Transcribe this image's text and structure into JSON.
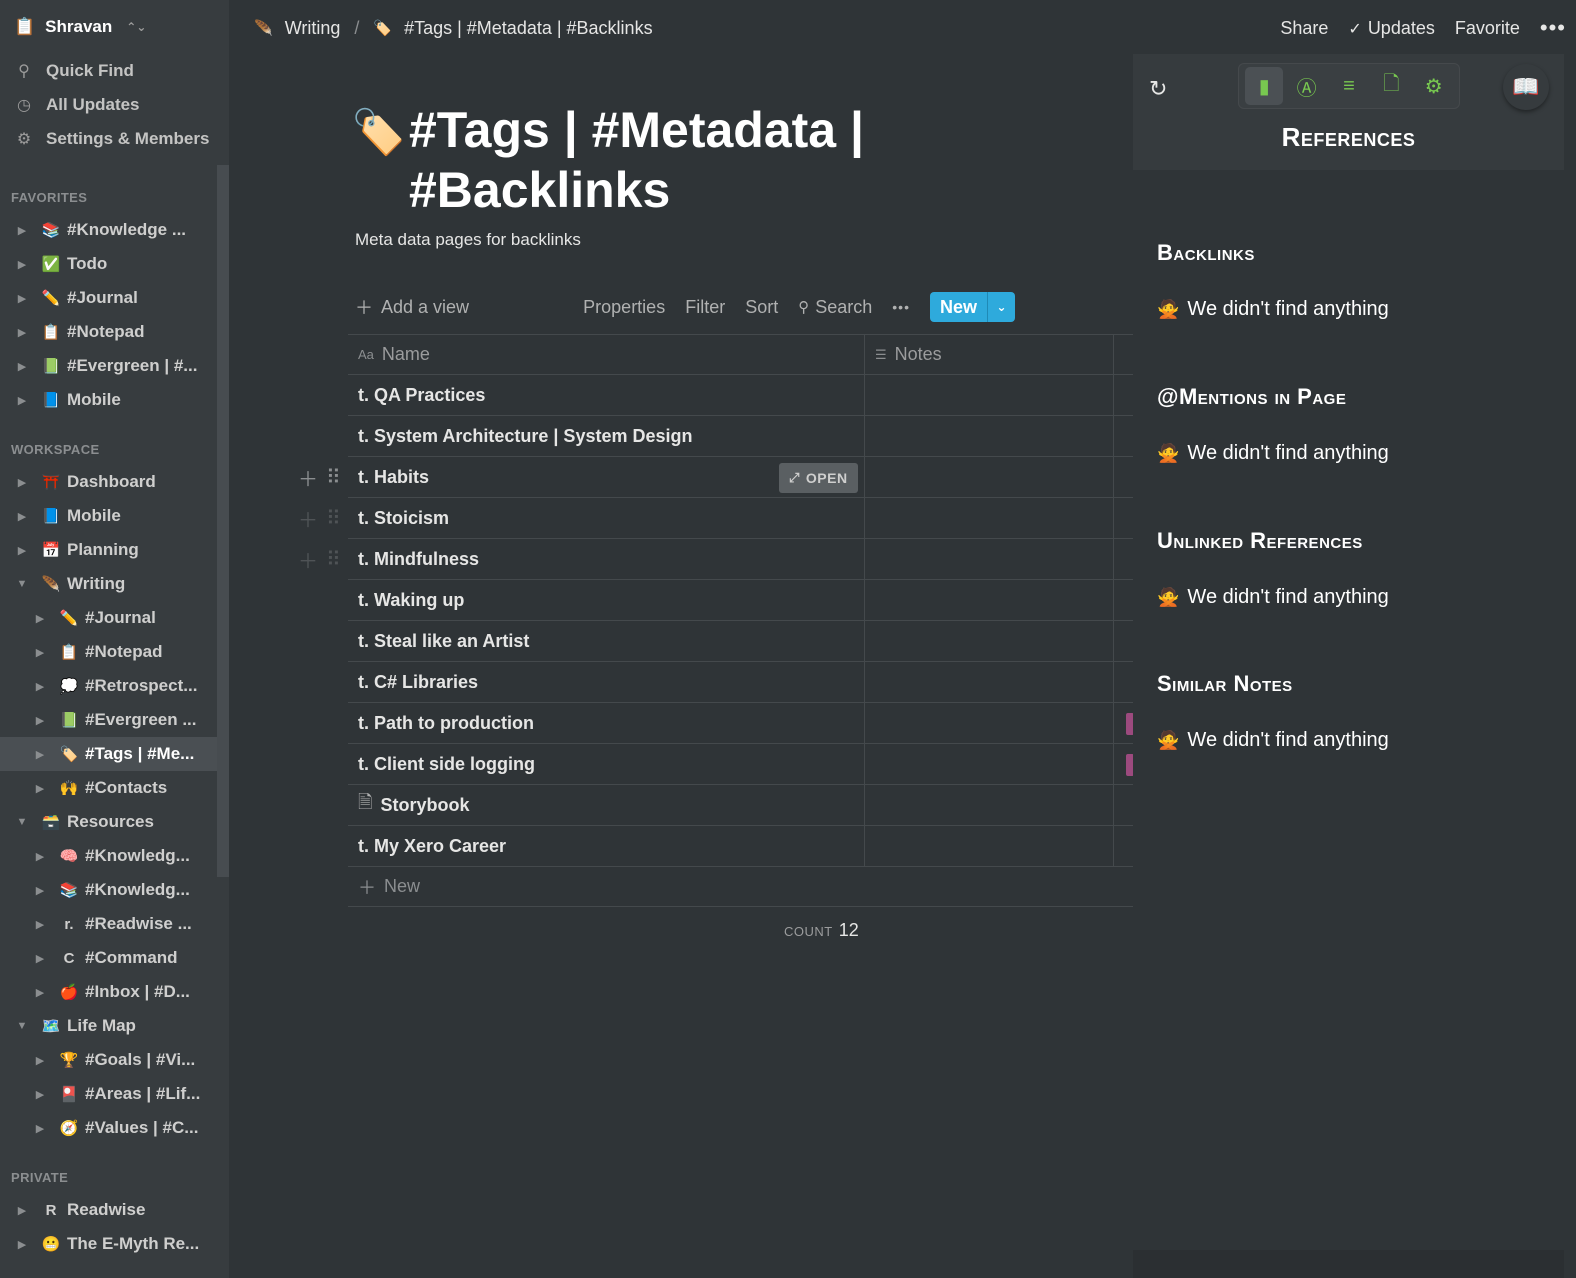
{
  "workspace": {
    "name": "Shravan"
  },
  "top_nav": [
    {
      "icon": "search-icon",
      "label": "Quick Find"
    },
    {
      "icon": "clock-icon",
      "label": "All Updates"
    },
    {
      "icon": "gear-icon",
      "label": "Settings & Members"
    }
  ],
  "favorites": {
    "label": "FAVORITES",
    "items": [
      {
        "emoji": "📚",
        "label": "#Knowledge ..."
      },
      {
        "emoji": "✅",
        "label": "Todo"
      },
      {
        "emoji": "✏️",
        "label": "#Journal"
      },
      {
        "emoji": "📋",
        "label": "#Notepad"
      },
      {
        "emoji": "📗",
        "label": "#Evergreen | #..."
      },
      {
        "emoji": "📘",
        "label": "Mobile"
      }
    ]
  },
  "workspace_section": {
    "label": "WORKSPACE",
    "items": [
      {
        "emoji": "⛩️",
        "label": "Dashboard"
      },
      {
        "emoji": "📘",
        "label": "Mobile"
      },
      {
        "emoji": "📅",
        "label": "Planning"
      },
      {
        "emoji": "🪶",
        "label": "Writing"
      },
      {
        "emoji": "✏️",
        "label": "#Journal"
      },
      {
        "emoji": "📋",
        "label": "#Notepad"
      },
      {
        "emoji": "💭",
        "label": "#Retrospect..."
      },
      {
        "emoji": "📗",
        "label": "#Evergreen ..."
      },
      {
        "emoji": "🏷️",
        "label": "#Tags | #Me..."
      },
      {
        "emoji": "🙌",
        "label": "#Contacts"
      },
      {
        "emoji": "🗃️",
        "label": "Resources"
      },
      {
        "emoji": "🧠",
        "label": "#Knowledg..."
      },
      {
        "emoji": "📚",
        "label": "#Knowledg..."
      },
      {
        "emoji": "r.",
        "label": "#Readwise ..."
      },
      {
        "emoji": "C",
        "label": "#Command"
      },
      {
        "emoji": "🍎",
        "label": "#Inbox | #D..."
      },
      {
        "emoji": "🗺️",
        "label": "Life Map"
      },
      {
        "emoji": "🏆",
        "label": "#Goals | #Vi..."
      },
      {
        "emoji": "🎴",
        "label": "#Areas | #Lif..."
      },
      {
        "emoji": "🧭",
        "label": "#Values | #C..."
      }
    ]
  },
  "private_section": {
    "label": "PRIVATE",
    "items": [
      {
        "emoji": "R",
        "label": "Readwise"
      },
      {
        "emoji": "😬",
        "label": "The E-Myth Re..."
      }
    ]
  },
  "breadcrumb": {
    "parent": "Writing",
    "current": "#Tags | #Metadata | #Backlinks"
  },
  "top_actions": {
    "share": "Share",
    "updates": "Updates",
    "favorite": "Favorite",
    "more": "•••"
  },
  "page": {
    "icon": "🏷️",
    "title": "#Tags | #Metadata | #Backlinks",
    "description": "Meta data pages for backlinks"
  },
  "db_toolbar": {
    "add_view": "Add a view",
    "properties": "Properties",
    "filter": "Filter",
    "sort": "Sort",
    "search": "Search",
    "more": "•••",
    "new": "New"
  },
  "table": {
    "columns": [
      "Name",
      "Notes"
    ],
    "rows": [
      {
        "name": "t. QA Practices"
      },
      {
        "name": "t. System Architecture | System Design"
      },
      {
        "name": "t. Habits"
      },
      {
        "name": "t. Stoicism"
      },
      {
        "name": "t. Mindfulness"
      },
      {
        "name": "t. Waking up"
      },
      {
        "name": "t. Steal like an Artist"
      },
      {
        "name": "t. C# Libraries"
      },
      {
        "name": "t. Path to production"
      },
      {
        "name": "t. Client side logging"
      },
      {
        "name": "Storybook"
      },
      {
        "name": "t. My Xero Career"
      }
    ],
    "open_label": "OPEN",
    "add_new": "New",
    "count_label": "COUNT",
    "count_value": "12"
  },
  "references": {
    "title": "References",
    "sections": [
      {
        "heading": "Backlinks",
        "empty": "We didn't find anything"
      },
      {
        "heading": "@Mentions in Page",
        "empty": "We didn't find anything"
      },
      {
        "heading": "Unlinked References",
        "empty": "We didn't find anything"
      },
      {
        "heading": "Similar Notes",
        "empty": "We didn't find anything"
      }
    ]
  },
  "colors": {
    "background": "#2f3437",
    "sidebar": "#373c3f",
    "accent_blue": "#2eaadc",
    "panel_green": "#78c850",
    "tag_pink": "#9c4a7e"
  }
}
